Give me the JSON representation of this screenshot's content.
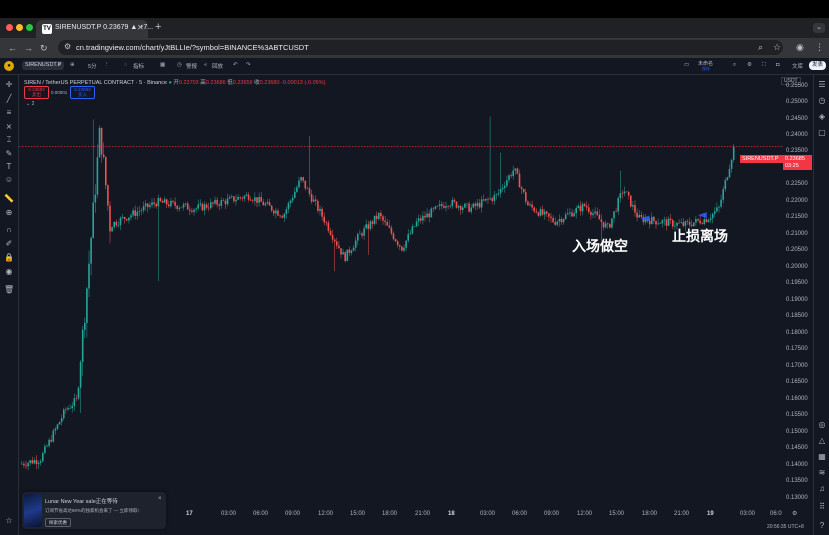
{
  "browser": {
    "tab_title": "SIRENUSDT.P 0.23679 ▲ +7...",
    "favicon_text": "TV",
    "url": "cn.tradingview.com/chart/yJtBLLIe/?symbol=BINANCE%3ABTCUSDT"
  },
  "toolbar": {
    "symbol": "SIRENUSDT.P",
    "interval": "5分",
    "indicators_label": "指标",
    "alert_label": "警报",
    "replay_label": "回放",
    "unnamed_label": "未命名",
    "save_label": "保存",
    "workspace_label": "文库",
    "publish_label": "发表"
  },
  "legend": {
    "pair": "SIREN / TetherUS PERPETUAL CONTRACT · 5 · Binance",
    "o_label": "开",
    "o_value": "0.23703",
    "h_label": "高",
    "h_value": "0.23686",
    "l_label": "低",
    "l_value": "0.23659",
    "c_label": "收",
    "c_value": "0.23680",
    "change": "-0.00013 (-0.05%)",
    "sell_price": "0.23683",
    "sell_label": "卖出",
    "spread": "0.00001",
    "buy_price": "0.23683",
    "buy_label": "买入",
    "collapse_label": "⌄ 2"
  },
  "price_axis": {
    "currency": "USDT",
    "ticks": [
      "0.25500",
      "0.25000",
      "0.24500",
      "0.24000",
      "0.23500",
      "0.23000",
      "0.22500",
      "0.22000",
      "0.21500",
      "0.21000",
      "0.20500",
      "0.20000",
      "0.19500",
      "0.19000",
      "0.18500",
      "0.18000",
      "0.17500",
      "0.17000",
      "0.16500",
      "0.16000",
      "0.15500",
      "0.15000",
      "0.14500",
      "0.14000",
      "0.13500",
      "0.13000"
    ],
    "current_symbol": "SIRENUSDT.P",
    "current_price": "0.23685",
    "countdown": "03:25"
  },
  "time_axis": {
    "labels": [
      {
        "t": "0",
        "bold": false
      },
      {
        "t": "17",
        "bold": true
      },
      {
        "t": "03:00",
        "bold": false
      },
      {
        "t": "06:00",
        "bold": false
      },
      {
        "t": "09:00",
        "bold": false
      },
      {
        "t": "12:00",
        "bold": false
      },
      {
        "t": "15:00",
        "bold": false
      },
      {
        "t": "18:00",
        "bold": false
      },
      {
        "t": "21:00",
        "bold": false
      },
      {
        "t": "18",
        "bold": true
      },
      {
        "t": "03:00",
        "bold": false
      },
      {
        "t": "06:00",
        "bold": false
      },
      {
        "t": "09:00",
        "bold": false
      },
      {
        "t": "12:00",
        "bold": false
      },
      {
        "t": "15:00",
        "bold": false
      },
      {
        "t": "18:00",
        "bold": false
      },
      {
        "t": "21:00",
        "bold": false
      },
      {
        "t": "19",
        "bold": true
      },
      {
        "t": "03:00",
        "bold": false
      },
      {
        "t": "06:0",
        "bold": false
      }
    ],
    "clock": "20:56:35 UTC+8"
  },
  "annotations": {
    "entry": "入场做空",
    "exit": "止损离场"
  },
  "promo": {
    "title": "Lunar New Year sale正在等待",
    "body": "订阅节省高达80%的独家机会来了 — 立即领取!",
    "button": "探索优惠",
    "close": "×"
  },
  "chart_data": {
    "type": "candlestick",
    "ylim": [
      0.1275,
      0.2585
    ],
    "series": [
      {
        "from_x": 0.0,
        "to_x": 0.027,
        "from": 0.1405,
        "to": 0.142
      },
      {
        "from_x": 0.027,
        "to_x": 0.06,
        "from": 0.142,
        "to": 0.157
      },
      {
        "from_x": 0.06,
        "to_x": 0.075,
        "from": 0.157,
        "to": 0.16
      },
      {
        "from_x": 0.075,
        "to_x": 0.09,
        "from": 0.16,
        "to": 0.2
      },
      {
        "from_x": 0.09,
        "to_x": 0.105,
        "from": 0.2,
        "to": 0.242
      },
      {
        "from_x": 0.105,
        "to_x": 0.118,
        "from": 0.242,
        "to": 0.213
      },
      {
        "from_x": 0.118,
        "to_x": 0.18,
        "from": 0.213,
        "to": 0.22
      },
      {
        "from_x": 0.18,
        "to_x": 0.23,
        "from": 0.22,
        "to": 0.218
      },
      {
        "from_x": 0.23,
        "to_x": 0.3,
        "from": 0.218,
        "to": 0.222
      },
      {
        "from_x": 0.3,
        "to_x": 0.345,
        "from": 0.222,
        "to": 0.216
      },
      {
        "from_x": 0.345,
        "to_x": 0.368,
        "from": 0.216,
        "to": 0.227
      },
      {
        "from_x": 0.368,
        "to_x": 0.4,
        "from": 0.227,
        "to": 0.214
      },
      {
        "from_x": 0.4,
        "to_x": 0.425,
        "from": 0.214,
        "to": 0.203
      },
      {
        "from_x": 0.425,
        "to_x": 0.445,
        "from": 0.203,
        "to": 0.21
      },
      {
        "from_x": 0.445,
        "to_x": 0.47,
        "from": 0.21,
        "to": 0.216
      },
      {
        "from_x": 0.47,
        "to_x": 0.5,
        "from": 0.216,
        "to": 0.206
      },
      {
        "from_x": 0.5,
        "to_x": 0.52,
        "from": 0.206,
        "to": 0.214
      },
      {
        "from_x": 0.52,
        "to_x": 0.56,
        "from": 0.214,
        "to": 0.22
      },
      {
        "from_x": 0.56,
        "to_x": 0.59,
        "from": 0.22,
        "to": 0.218
      },
      {
        "from_x": 0.59,
        "to_x": 0.625,
        "from": 0.218,
        "to": 0.222
      },
      {
        "from_x": 0.625,
        "to_x": 0.635,
        "from": 0.222,
        "to": 0.226
      },
      {
        "from_x": 0.635,
        "to_x": 0.647,
        "from": 0.226,
        "to": 0.23
      },
      {
        "from_x": 0.647,
        "to_x": 0.665,
        "from": 0.23,
        "to": 0.219
      },
      {
        "from_x": 0.665,
        "to_x": 0.7,
        "from": 0.219,
        "to": 0.214
      },
      {
        "from_x": 0.7,
        "to_x": 0.74,
        "from": 0.214,
        "to": 0.219
      },
      {
        "from_x": 0.74,
        "to_x": 0.77,
        "from": 0.219,
        "to": 0.212
      },
      {
        "from_x": 0.77,
        "to_x": 0.79,
        "from": 0.212,
        "to": 0.224
      },
      {
        "from_x": 0.79,
        "to_x": 0.81,
        "from": 0.224,
        "to": 0.215
      },
      {
        "from_x": 0.81,
        "to_x": 0.84,
        "from": 0.215,
        "to": 0.214
      },
      {
        "from_x": 0.84,
        "to_x": 0.87,
        "from": 0.214,
        "to": 0.213
      },
      {
        "from_x": 0.87,
        "to_x": 0.9,
        "from": 0.213,
        "to": 0.215
      },
      {
        "from_x": 0.9,
        "to_x": 0.915,
        "from": 0.215,
        "to": 0.218
      },
      {
        "from_x": 0.915,
        "to_x": 0.935,
        "from": 0.218,
        "to": 0.2369
      }
    ],
    "spikes": [
      {
        "x": 0.096,
        "value": 0.245
      },
      {
        "x": 0.11,
        "value": 0.238
      },
      {
        "x": 0.38,
        "value": 0.24
      },
      {
        "x": 0.615,
        "value": 0.246
      },
      {
        "x": 0.63,
        "value": 0.235
      },
      {
        "x": 0.785,
        "value": 0.2295
      }
    ],
    "dips": [
      {
        "x": 0.08,
        "value": 0.156
      },
      {
        "x": 0.18,
        "value": 0.196
      },
      {
        "x": 0.412,
        "value": 0.199
      },
      {
        "x": 0.455,
        "value": 0.204
      },
      {
        "x": 0.762,
        "value": 0.208
      }
    ],
    "current_price": 0.23685,
    "markers": [
      {
        "x": 0.82,
        "value": 0.215,
        "color": "#2962ff"
      },
      {
        "x": 0.895,
        "value": 0.216,
        "color": "#2962ff"
      }
    ]
  }
}
